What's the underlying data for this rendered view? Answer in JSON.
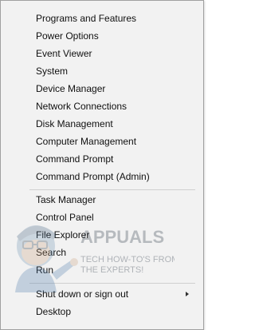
{
  "menu": {
    "group1": [
      {
        "label": "Programs and Features"
      },
      {
        "label": "Power Options"
      },
      {
        "label": "Event Viewer"
      },
      {
        "label": "System"
      },
      {
        "label": "Device Manager"
      },
      {
        "label": "Network Connections"
      },
      {
        "label": "Disk Management"
      },
      {
        "label": "Computer Management"
      },
      {
        "label": "Command Prompt"
      },
      {
        "label": "Command Prompt (Admin)"
      }
    ],
    "group2": [
      {
        "label": "Task Manager"
      },
      {
        "label": "Control Panel"
      },
      {
        "label": "File Explorer"
      },
      {
        "label": "Search"
      },
      {
        "label": "Run"
      }
    ],
    "group3": [
      {
        "label": "Shut down or sign out",
        "icon": "chevron-right-icon"
      },
      {
        "label": "Desktop"
      }
    ]
  },
  "watermark": {
    "brand": "APPUALS",
    "tagline_line1": "TECH HOW-TO'S FROM",
    "tagline_line2": "THE EXPERTS!"
  },
  "colors": {
    "menu_background": "#f2f2f2",
    "menu_border": "#a0a0a0",
    "separator": "#d0d0d0",
    "text": "#101010"
  }
}
